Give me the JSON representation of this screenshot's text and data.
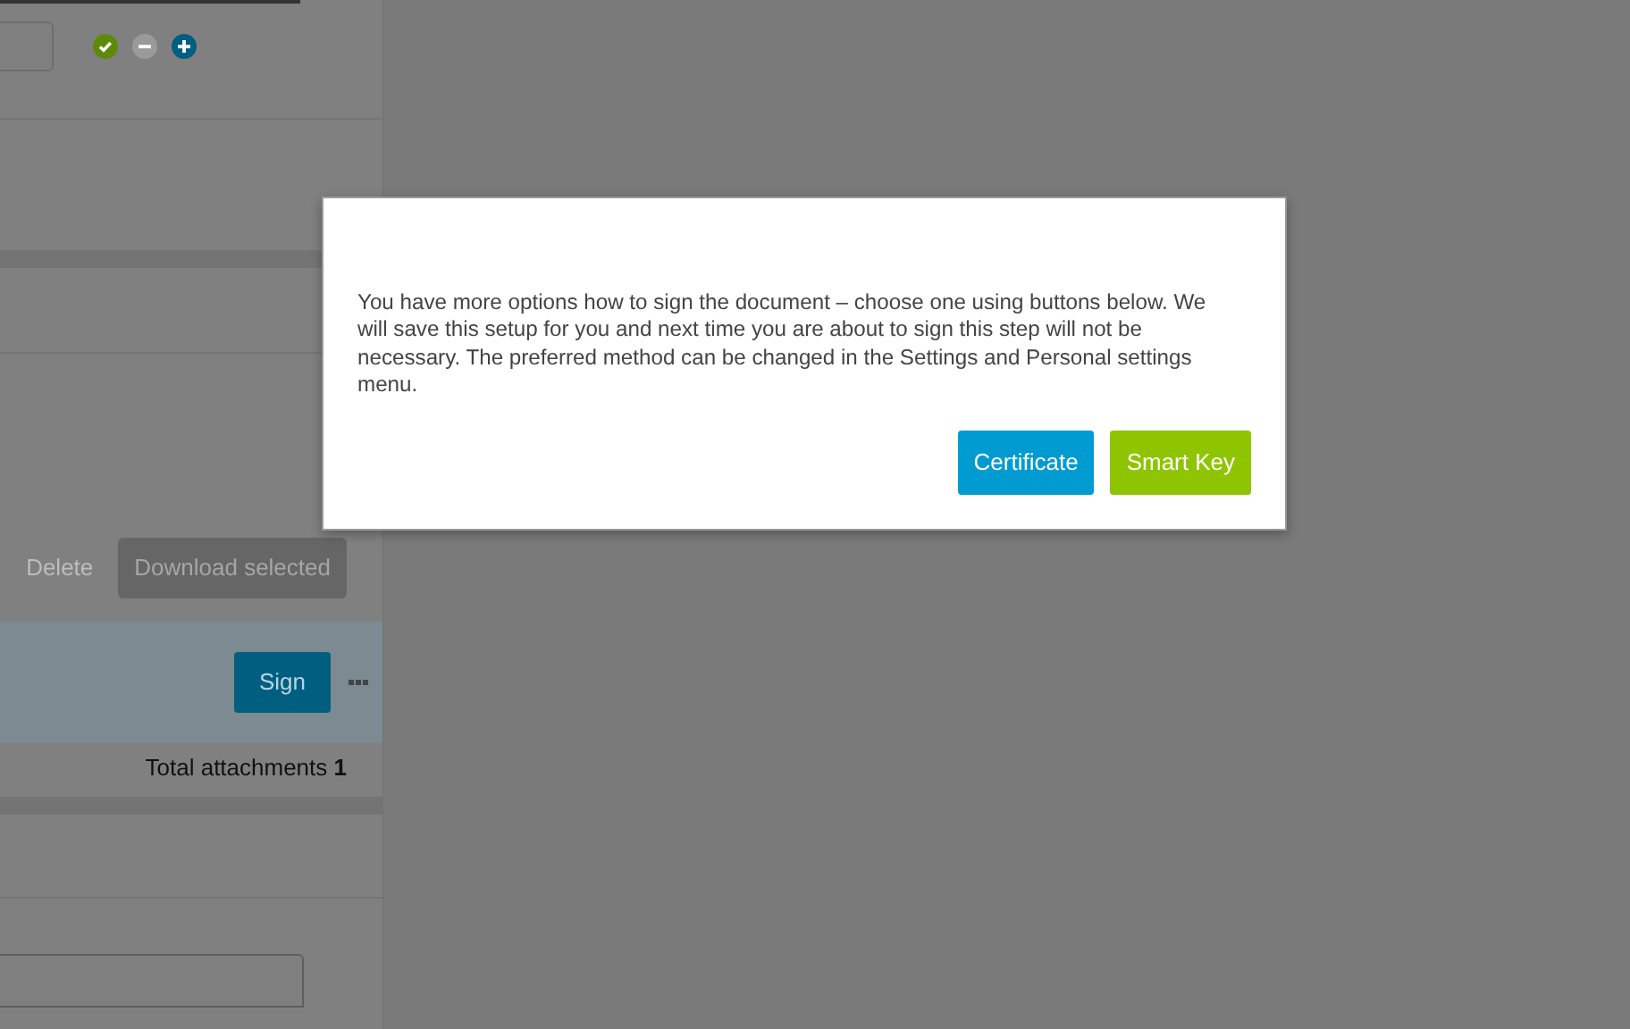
{
  "toolbar": {
    "status_icons": [
      {
        "kind": "check",
        "color": "#5e8a0a"
      },
      {
        "kind": "minus",
        "color": "#9a9a9a"
      },
      {
        "kind": "plus",
        "color": "#005f80"
      }
    ]
  },
  "attachments": {
    "actions": [
      {
        "label": "Delete",
        "kind": "link",
        "disabled": true
      },
      {
        "label": "Download selected",
        "kind": "button",
        "disabled": true
      }
    ],
    "row": {
      "sign_button": "Sign"
    },
    "total": "Total attachments **1**"
  },
  "modal": {
    "message": "You have more options how to sign the document – choose one using buttons below. We will save this setup for you and next time you are about to sign this step will not be necessary. The preferred method can be changed in the Settings and Personal settings menu.",
    "buttons": [
      {
        "label": "Certificate",
        "kind": "certificate"
      },
      {
        "label": "Smart Key",
        "kind": "smartkey"
      }
    ]
  }
}
